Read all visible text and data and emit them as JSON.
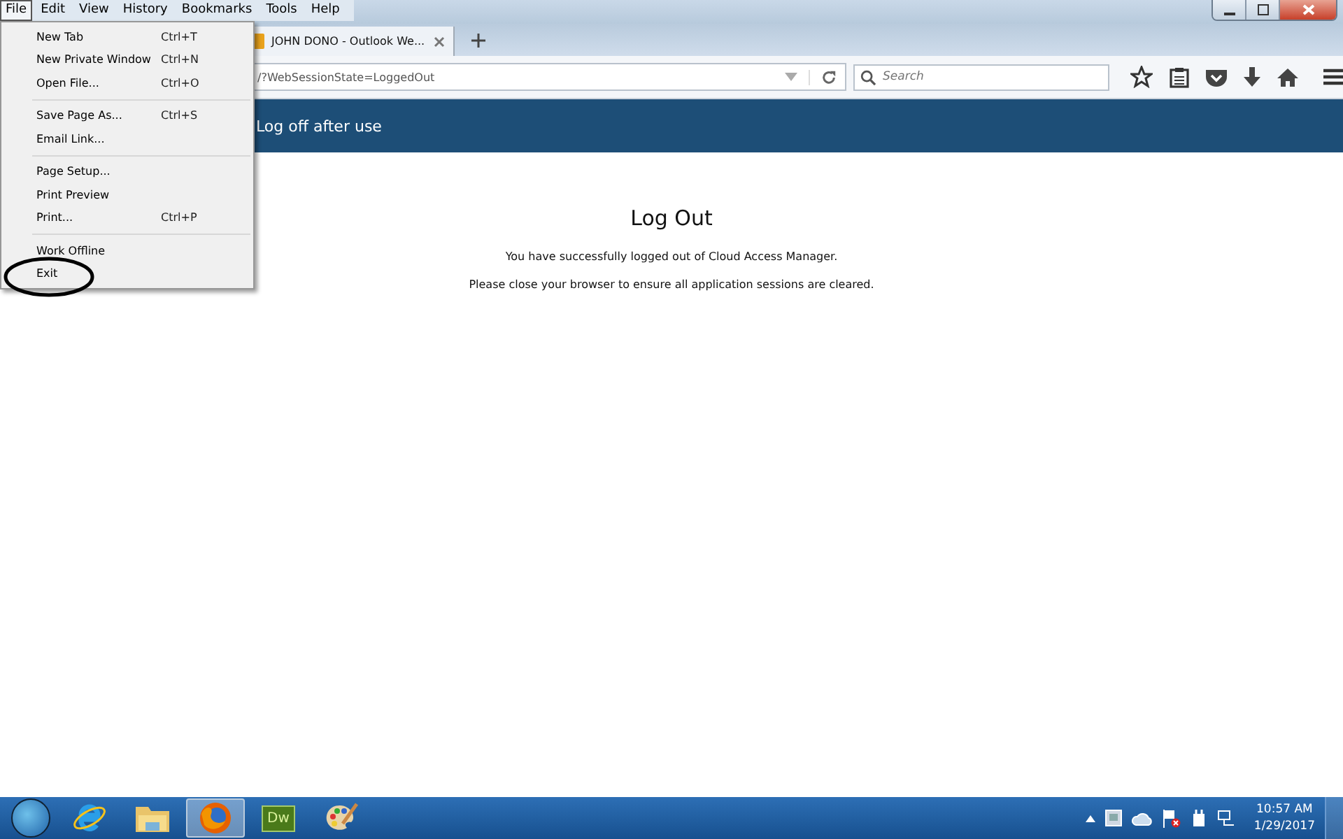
{
  "menubar": [
    {
      "label": "File",
      "selected": true
    },
    {
      "label": "Edit",
      "selected": false
    },
    {
      "label": "View",
      "selected": false
    },
    {
      "label": "History",
      "selected": false
    },
    {
      "label": "Bookmarks",
      "selected": false
    },
    {
      "label": "Tools",
      "selected": false
    },
    {
      "label": "Help",
      "selected": false
    }
  ],
  "file_menu": [
    {
      "kind": "item",
      "label": "New Tab",
      "shortcut": "Ctrl+T"
    },
    {
      "kind": "item",
      "label": "New Private Window",
      "shortcut": "Ctrl+N"
    },
    {
      "kind": "item",
      "label": "Open File...",
      "shortcut": "Ctrl+O"
    },
    {
      "kind": "separator"
    },
    {
      "kind": "item",
      "label": "Save Page As...",
      "shortcut": "Ctrl+S"
    },
    {
      "kind": "item",
      "label": "Email Link..."
    },
    {
      "kind": "separator"
    },
    {
      "kind": "item",
      "label": "Page Setup..."
    },
    {
      "kind": "item",
      "label": "Print Preview"
    },
    {
      "kind": "item",
      "label": "Print...",
      "shortcut": "Ctrl+P"
    },
    {
      "kind": "separator"
    },
    {
      "kind": "item",
      "label": "Work Offline"
    },
    {
      "kind": "item",
      "label": "Exit"
    }
  ],
  "tab": {
    "title": "JOHN DONO - Outlook We..."
  },
  "address_bar": {
    "value": "/?WebSessionState=LoggedOut"
  },
  "search": {
    "placeholder": "Search"
  },
  "banner": {
    "title": "Log off after use"
  },
  "page": {
    "heading": "Log Out",
    "messages": [
      "You have successfully logged out of Cloud Access Manager.",
      "Please close your browser to ensure all application sessions are cleared."
    ]
  },
  "taskbar": {
    "apps": [
      {
        "kind": "ie",
        "selected": false
      },
      {
        "kind": "folder",
        "selected": false
      },
      {
        "kind": "firefox",
        "selected": true
      },
      {
        "kind": "dw",
        "label": "Dw",
        "selected": false
      },
      {
        "kind": "paint",
        "selected": false
      }
    ]
  },
  "clock": {
    "time": "10:57 AM",
    "date": "1/29/2017"
  }
}
